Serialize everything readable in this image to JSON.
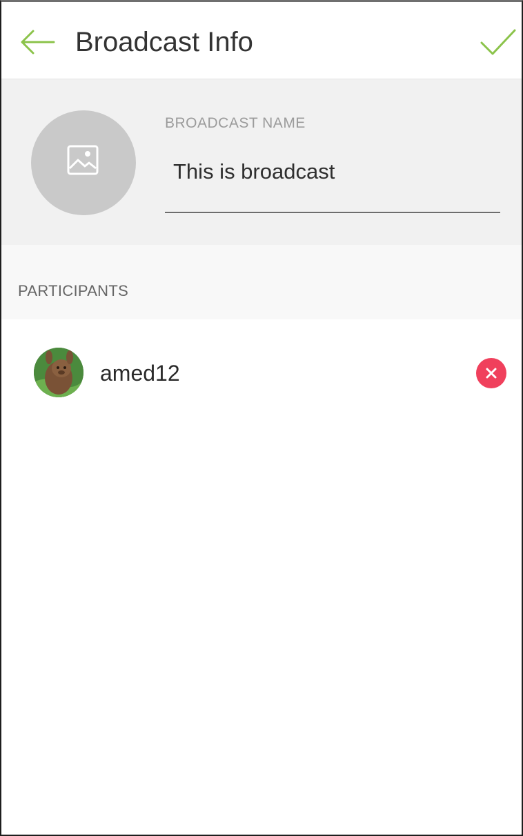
{
  "header": {
    "title": "Broadcast Info",
    "back_icon": "arrow-left-icon",
    "confirm_icon": "checkmark-icon",
    "accent_color": "#8bc34a"
  },
  "broadcast": {
    "avatar_icon": "image-placeholder-icon",
    "name_label": "BROADCAST NAME",
    "name_value": "This is broadcast"
  },
  "participants": {
    "section_label": "PARTICIPANTS",
    "items": [
      {
        "name": "amed12",
        "avatar_icon": "user-avatar-icon",
        "remove_icon": "remove-icon",
        "remove_color": "#f0405c"
      }
    ]
  }
}
